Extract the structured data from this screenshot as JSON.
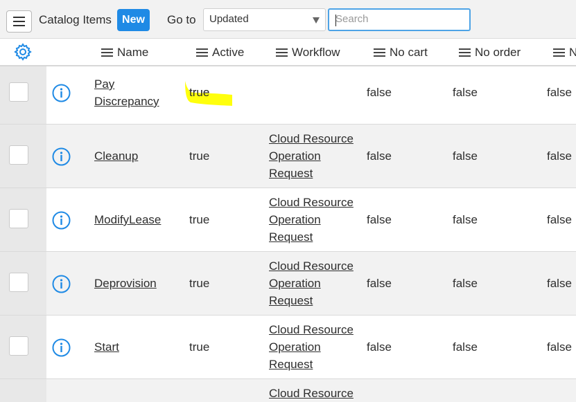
{
  "toolbar": {
    "title": "Catalog Items",
    "new_label": "New",
    "goto_label": "Go to",
    "goto_selected": "Updated",
    "search_placeholder": "Search"
  },
  "columns": [
    "Name",
    "Active",
    "Workflow",
    "No cart",
    "No order",
    "N"
  ],
  "rows": [
    {
      "name_line1": "Pay",
      "name_line2": "Discrepancy",
      "active": "true",
      "workflow": [
        "",
        "",
        ""
      ],
      "no_cart": "false",
      "no_order": "false",
      "next": "false"
    },
    {
      "name": "Cleanup",
      "active": "true",
      "workflow": [
        "Cloud Resource",
        "Operation",
        "Request"
      ],
      "no_cart": "false",
      "no_order": "false",
      "next": "false"
    },
    {
      "name": "ModifyLease",
      "active": "true",
      "workflow": [
        "Cloud Resource",
        "Operation",
        "Request"
      ],
      "no_cart": "false",
      "no_order": "false",
      "next": "false"
    },
    {
      "name": "Deprovision",
      "active": "true",
      "workflow": [
        "Cloud Resource",
        "Operation",
        "Request"
      ],
      "no_cart": "false",
      "no_order": "false",
      "next": "false"
    },
    {
      "name": "Start",
      "active": "true",
      "workflow": [
        "Cloud Resource",
        "Operation",
        "Request"
      ],
      "no_cart": "false",
      "no_order": "false",
      "next": "false"
    },
    {
      "workflow": [
        "Cloud Resource"
      ]
    }
  ],
  "colors": {
    "accent": "#1f8ae5",
    "highlight": "#ffff00",
    "search_border": "#4da3e6"
  }
}
